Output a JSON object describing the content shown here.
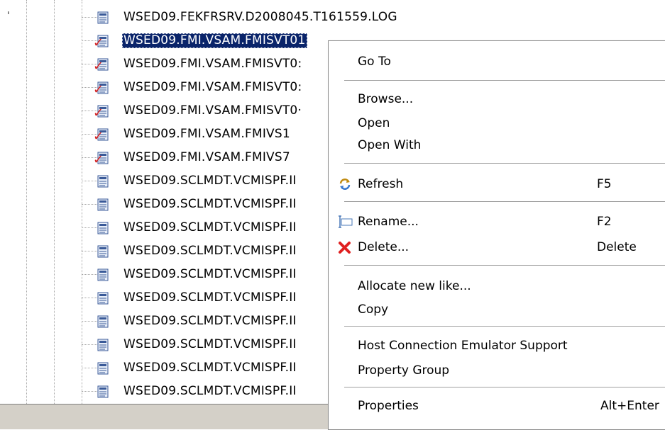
{
  "tree": {
    "rows": [
      {
        "label": "WSED09.FEKFRSRV.D2008045.T161559.LOG",
        "marked": false,
        "selected": false
      },
      {
        "label": "WSED09.FMI.VSAM.FMISVT01",
        "marked": true,
        "selected": true
      },
      {
        "label": "WSED09.FMI.VSAM.FMISVT0:",
        "marked": true,
        "selected": false
      },
      {
        "label": "WSED09.FMI.VSAM.FMISVT0:",
        "marked": true,
        "selected": false
      },
      {
        "label": "WSED09.FMI.VSAM.FMISVT0·",
        "marked": true,
        "selected": false
      },
      {
        "label": "WSED09.FMI.VSAM.FMIVS1",
        "marked": true,
        "selected": false
      },
      {
        "label": "WSED09.FMI.VSAM.FMIVS7",
        "marked": true,
        "selected": false
      },
      {
        "label": "WSED09.SCLMDT.VCMISPF.II",
        "marked": false,
        "selected": false
      },
      {
        "label": "WSED09.SCLMDT.VCMISPF.II",
        "marked": false,
        "selected": false
      },
      {
        "label": "WSED09.SCLMDT.VCMISPF.II",
        "marked": false,
        "selected": false
      },
      {
        "label": "WSED09.SCLMDT.VCMISPF.II",
        "marked": false,
        "selected": false
      },
      {
        "label": "WSED09.SCLMDT.VCMISPF.II",
        "marked": false,
        "selected": false
      },
      {
        "label": "WSED09.SCLMDT.VCMISPF.II",
        "marked": false,
        "selected": false
      },
      {
        "label": "WSED09.SCLMDT.VCMISPF.II",
        "marked": false,
        "selected": false
      },
      {
        "label": "WSED09.SCLMDT.VCMISPF.II",
        "marked": false,
        "selected": false
      },
      {
        "label": "WSED09.SCLMDT.VCMISPF.II",
        "marked": false,
        "selected": false
      },
      {
        "label": "WSED09.SCLMDT.VCMISPF.II",
        "marked": false,
        "selected": false
      }
    ]
  },
  "context_menu": {
    "go_to": "Go To",
    "browse": "Browse...",
    "open": "Open",
    "open_with": "Open With",
    "refresh": "Refresh",
    "refresh_shortcut": "F5",
    "rename": "Rename...",
    "rename_shortcut": "F2",
    "delete": "Delete...",
    "delete_shortcut": "Delete",
    "allocate_new_like": "Allocate new like...",
    "copy": "Copy",
    "host_connection": "Host Connection Emulator Support",
    "property_group": "Property Group",
    "properties": "Properties",
    "properties_shortcut": "Alt+Enter"
  },
  "colors": {
    "selection": "#0a246a",
    "menu_bg": "#ffffff",
    "statusbar_bg": "#d4d0c8",
    "check_red": "#d42020"
  },
  "icons": [
    "dataset-file-icon",
    "red-check-icon",
    "refresh-icon",
    "rename-icon",
    "delete-icon"
  ]
}
